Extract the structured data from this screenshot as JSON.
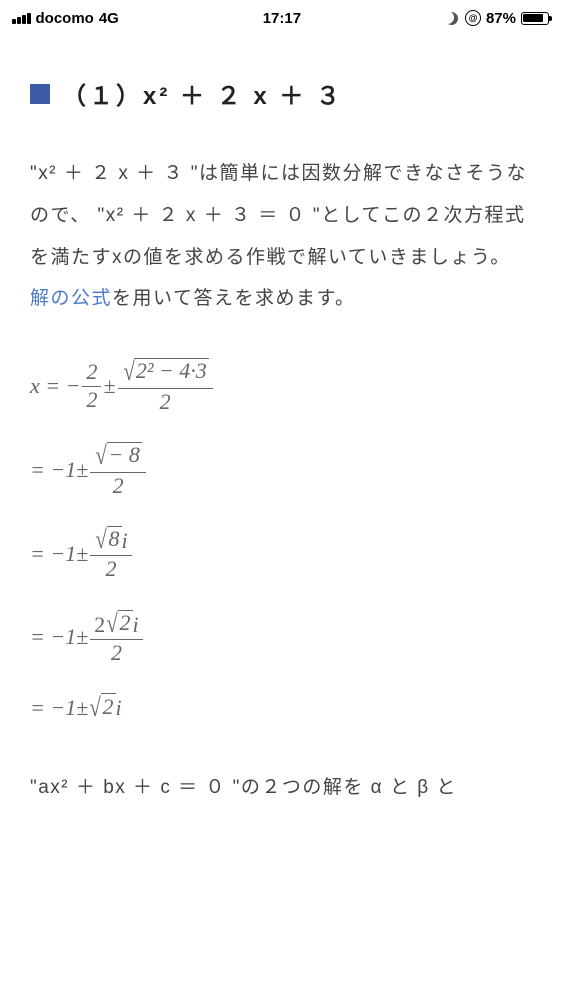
{
  "status": {
    "carrier": "docomo",
    "net": "4G",
    "time": "17:17",
    "ring": "@",
    "pct": "87%",
    "fill": "87%"
  },
  "heading": {
    "num": "（１）",
    "expr": "x² ＋ ２ x ＋ ３"
  },
  "body": {
    "t1": "\"x² ＋ ２ x ＋ ３ \"は簡単には因数分解できなさそうなので、 \"x² ＋ ２ x ＋ ３ ＝ ０ \"としてこの２次方程式を満たすxの値を求める作戦で解いていきましょう。",
    "link": "解の公式",
    "t2": "を用いて答えを求めます。"
  },
  "eq": {
    "l1": {
      "lhs": "x = −",
      "f1n": "2",
      "f1d": "2",
      "pm": "±",
      "rad": "2² − 4·3",
      "f2d": "2"
    },
    "l2": {
      "lhs": "= −1±",
      "rad": "− 8",
      "fd": "2"
    },
    "l3": {
      "lhs": "= −1±",
      "rad": "8",
      "i": "i",
      "fd": "2"
    },
    "l4": {
      "lhs": "= −1±",
      "fn": "2",
      "rad": "2",
      "i": "i",
      "fd": "2"
    },
    "l5": {
      "lhs": "= −1±",
      "rad": "2",
      "i": "i"
    }
  },
  "footer": "\"ax² ＋ bx ＋ c ＝ ０ \"の２つの解を α と β と"
}
